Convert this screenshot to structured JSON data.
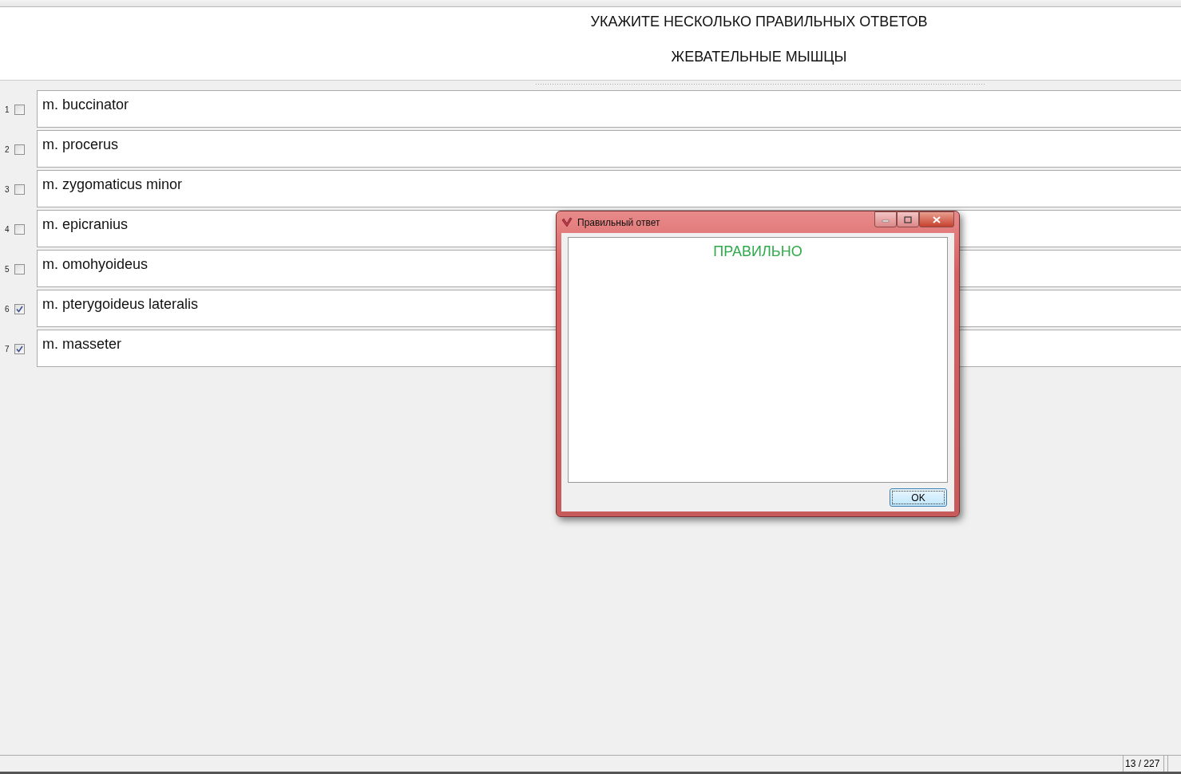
{
  "header": {
    "instruction": "УКАЖИТЕ НЕСКОЛЬКО ПРАВИЛЬНЫХ ОТВЕТОВ",
    "question": "ЖЕВАТЕЛЬНЫЕ МЫШЦЫ"
  },
  "answers": [
    {
      "number": "1",
      "text": "m. buccinator",
      "checked": false
    },
    {
      "number": "2",
      "text": "m. procerus",
      "checked": false
    },
    {
      "number": "3",
      "text": "m. zygomaticus minor",
      "checked": false
    },
    {
      "number": "4",
      "text": "m. epicranius",
      "checked": false
    },
    {
      "number": "5",
      "text": "m. omohyoideus",
      "checked": false
    },
    {
      "number": "6",
      "text": "m. pterygoideus lateralis",
      "checked": true
    },
    {
      "number": "7",
      "text": "m. masseter",
      "checked": true
    }
  ],
  "dialog": {
    "title": "Правильный ответ",
    "message": "ПРАВИЛЬНО",
    "ok_button": "OK"
  },
  "status_bar": {
    "counter": "13 / 227"
  }
}
